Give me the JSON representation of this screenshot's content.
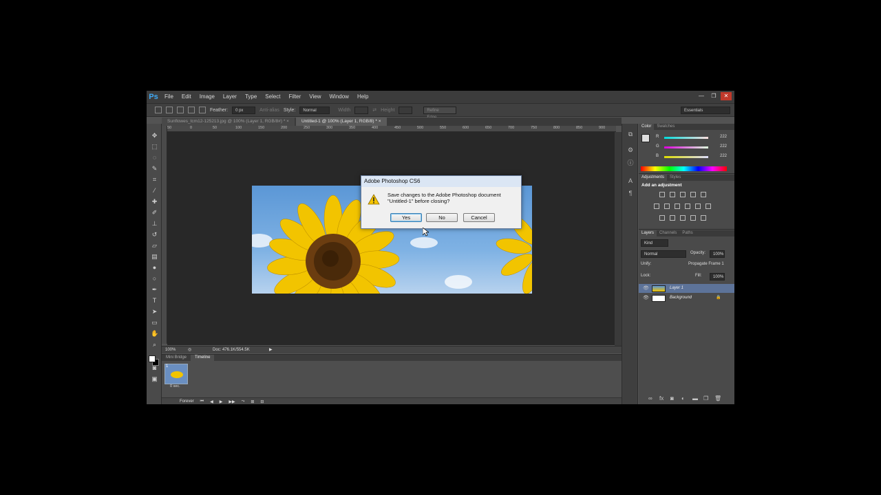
{
  "app": {
    "logo_text": "Ps",
    "menu": [
      "File",
      "Edit",
      "Image",
      "Layer",
      "Type",
      "Select",
      "Filter",
      "View",
      "Window",
      "Help"
    ],
    "window_controls": [
      "—",
      "❐",
      "✕"
    ]
  },
  "options_bar": {
    "feather_label": "Feather:",
    "feather_value": "0 px",
    "anti_alias_label": "Anti-alias",
    "style_label": "Style:",
    "style_value": "Normal",
    "width_label": "Width",
    "height_label": "Height",
    "refine_edge_label": "Refine Edge...",
    "workspace_value": "Essentials"
  },
  "tabs": [
    {
      "label": "Sunflowes_tcm12-125213.jpg @ 100% (Layer 1, RGB/8#) *",
      "close": "×",
      "active": false
    },
    {
      "label": "Untitled-1 @ 100% (Layer 1, RGB/8) *",
      "close": "×",
      "active": true
    }
  ],
  "rulers": {
    "top_ticks": [
      "50",
      "0",
      "50",
      "100",
      "150",
      "200",
      "250",
      "300",
      "350",
      "400",
      "450",
      "500",
      "550",
      "600",
      "650",
      "700",
      "750",
      "800",
      "850",
      "900"
    ]
  },
  "status_bar": {
    "zoom": "100%",
    "doc_info": "Doc: 476.1K/554.5K"
  },
  "timeline": {
    "tabs": [
      "Mini Bridge",
      "Timeline"
    ],
    "frame_number": "1",
    "frame_delay": "0 sec.",
    "loop_label": "Forever"
  },
  "color_panel": {
    "tabs": [
      "Color",
      "Swatches"
    ],
    "channels": [
      {
        "label": "R",
        "value": "222"
      },
      {
        "label": "G",
        "value": "222"
      },
      {
        "label": "B",
        "value": "222"
      }
    ]
  },
  "adjustments_panel": {
    "tabs": [
      "Adjustments",
      "Styles"
    ],
    "title": "Add an adjustment"
  },
  "layers_panel": {
    "tabs": [
      "Layers",
      "Channels",
      "Paths"
    ],
    "kind_label": "Kind",
    "blend_mode": "Normal",
    "opacity_label": "Opacity:",
    "opacity_value": "100%",
    "unify_label": "Unify:",
    "propagate_label": "Propagate Frame 1",
    "lock_label": "Lock:",
    "fill_label": "Fill:",
    "fill_value": "100%",
    "layers": [
      {
        "name": "Layer 1",
        "selected": true
      },
      {
        "name": "Background",
        "selected": false
      }
    ]
  },
  "dialog": {
    "title": "Adobe Photoshop CS6",
    "message_line1": "Save changes to the Adobe Photoshop document",
    "message_line2": "\"Untitled-1\" before closing?",
    "yes_label": "Yes",
    "no_label": "No",
    "cancel_label": "Cancel"
  },
  "colors": {
    "ps_blue": "#3fa9f5",
    "sky": "#5b97d6",
    "sunflower": "#f2c400"
  }
}
